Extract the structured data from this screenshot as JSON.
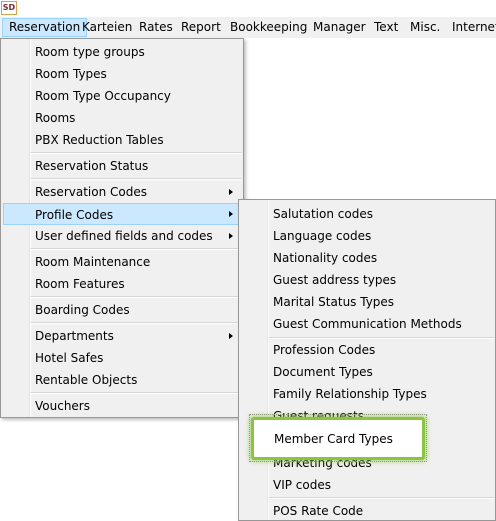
{
  "app": {
    "icon_text": "SD"
  },
  "menubar": {
    "items": [
      "Reservation",
      "Karteien",
      "Rates",
      "Report",
      "Bookkeeping",
      "Manager",
      "Text",
      "Misc.",
      "Internet"
    ]
  },
  "reservation_menu": {
    "groups": [
      [
        "Room type groups",
        "Room Types",
        "Room Type Occupancy",
        "Rooms",
        "PBX Reduction Tables"
      ],
      [
        "Reservation Status"
      ],
      [
        "Reservation Codes",
        "Profile Codes",
        "User defined fields and codes"
      ],
      [
        "Room Maintenance",
        "Room Features"
      ],
      [
        "Boarding Codes"
      ],
      [
        "Departments",
        "Hotel Safes",
        "Rentable Objects"
      ],
      [
        "Vouchers"
      ]
    ]
  },
  "profile_codes_submenu": {
    "items": [
      "Salutation codes",
      "Language codes",
      "Nationality codes",
      "Guest address types",
      "Marital Status Types",
      "Guest Communication Methods",
      "Profession Codes",
      "Document Types",
      "Family Relationship Types",
      "Guest requests",
      "Marketing codes",
      "VIP codes",
      "POS Rate Code"
    ]
  },
  "callout": {
    "label": "Member Card Types",
    "color": "#8bc53f"
  },
  "colors": {
    "menu_bg": "#f0f0f0",
    "highlight_bg": "#cce8ff",
    "highlight_border": "#99d1ff"
  }
}
